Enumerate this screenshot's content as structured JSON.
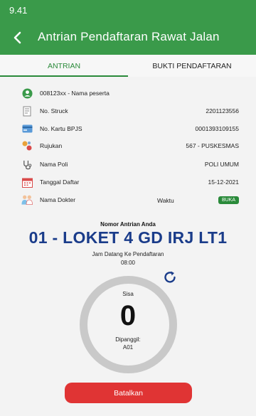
{
  "status_bar": {
    "time": "9.41"
  },
  "header": {
    "title": "Antrian Pendaftaran Rawat Jalan",
    "back_icon": "back-arrow-icon"
  },
  "tabs": [
    {
      "label": "ANTRIAN",
      "active": true
    },
    {
      "label": "BUKTI PENDAFTARAN",
      "active": false
    }
  ],
  "info": {
    "peserta": {
      "label": "008123xx - Nama peserta",
      "icon": "user-circle-icon"
    },
    "struck": {
      "label": "No. Struck",
      "value": "2201123556",
      "icon": "receipt-icon"
    },
    "bpjs": {
      "label": "No. Kartu BPJS",
      "value": "0001393109155",
      "icon": "card-icon"
    },
    "rujukan": {
      "label": "Rujukan",
      "value": "567 - PUSKESMAS",
      "icon": "referral-icon"
    },
    "poli": {
      "label": "Nama Poli",
      "value": "POLI UMUM",
      "icon": "stethoscope-icon"
    },
    "tanggal": {
      "label": "Tanggal Daftar",
      "value": "15-12-2021",
      "icon": "calendar-icon"
    },
    "dokter": {
      "label": "Nama Dokter",
      "waktu_label": "Waktu",
      "status": "BUKA",
      "icon": "doctor-icon"
    }
  },
  "queue": {
    "number_label": "Nomor Antrian Anda",
    "number": "01 - LOKET 4 GD IRJ LT1",
    "jam_label": "Jam Datang Ke Pendaftaran",
    "jam_value": "08:00",
    "sisa_label": "Sisa",
    "sisa_value": "0",
    "dipanggil_label": "Dipanggil:",
    "dipanggil_value": "A01"
  },
  "actions": {
    "cancel_label": "Batalkan"
  },
  "colors": {
    "primary": "#3a9a4a",
    "queue_number": "#1a3c8a",
    "danger": "#e03434",
    "badge": "#2a8a3a"
  }
}
